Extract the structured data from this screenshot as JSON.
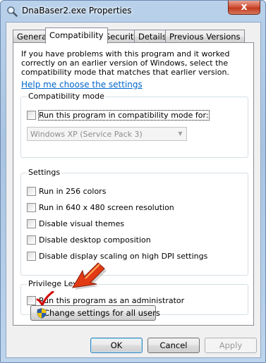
{
  "window": {
    "title": "DnaBaser2.exe Properties",
    "close_label": "x"
  },
  "tabs": [
    {
      "label": "General"
    },
    {
      "label": "Compatibility",
      "active": true
    },
    {
      "label": "Security"
    },
    {
      "label": "Details"
    },
    {
      "label": "Previous Versions"
    }
  ],
  "compat": {
    "intro": "If you have problems with this program and it worked correctly on an earlier version of Windows, select the compatibility mode that matches that earlier version.",
    "help_link": "Help me choose the settings",
    "mode_group": {
      "label": "Compatibility mode",
      "checkbox_label": "Run this program in compatibility mode for:",
      "checked": false,
      "select_value": "Windows XP (Service Pack 3)"
    },
    "settings_group": {
      "label": "Settings",
      "items": [
        {
          "label": "Run in 256 colors",
          "checked": false
        },
        {
          "label": "Run in 640 x 480 screen resolution",
          "checked": false
        },
        {
          "label": "Disable visual themes",
          "checked": false
        },
        {
          "label": "Disable desktop composition",
          "checked": false
        },
        {
          "label": "Disable display scaling on high DPI settings",
          "checked": false
        }
      ]
    },
    "privilege_group": {
      "label": "Privilege Level",
      "checkbox_label": "Run this program as an administrator",
      "checked": true
    },
    "all_users_button": "Change settings for all users"
  },
  "footer": {
    "ok": "OK",
    "cancel": "Cancel",
    "apply": "Apply"
  },
  "colors": {
    "link": "#0066cc",
    "annotation_red": "#d20000"
  },
  "icons": {
    "app": "magnifier-icon",
    "shield": "uac-shield-icon",
    "annotation_arrow": "red-arrow-icon",
    "annotation_check": "red-checkmark-icon"
  }
}
